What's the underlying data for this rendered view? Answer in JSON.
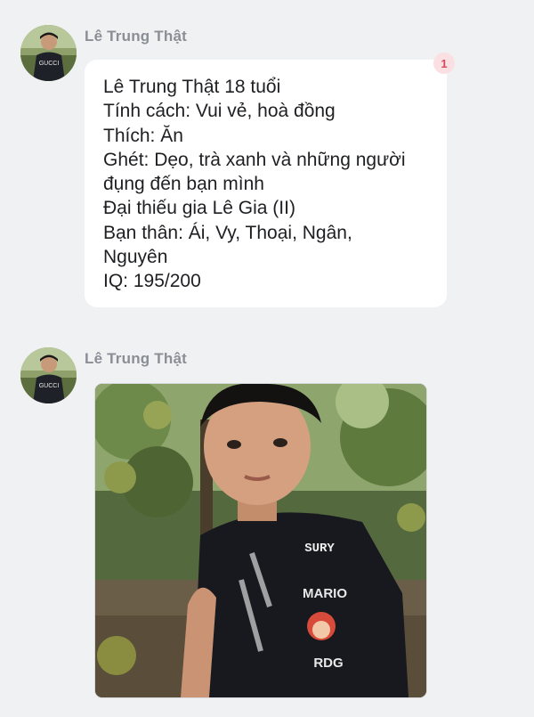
{
  "messages": [
    {
      "sender": "Lê Trung Thật",
      "avatar_icon": "person-avatar",
      "text_lines": [
        "Lê Trung Thật 18 tuổi",
        "Tính cách: Vui vẻ, hoà đồng",
        "Thích: Ăn",
        "Ghét: Dẹo, trà xanh và những người",
        "đụng đến bạn mình",
        "Đại thiếu gia Lê Gia (II)",
        "Bạn thân: Ái, Vy, Thoại, Ngân,",
        "Nguyên",
        "IQ: 195/200"
      ],
      "reaction_count": "1"
    },
    {
      "sender": "Lê Trung Thật",
      "avatar_icon": "person-avatar",
      "photo": {
        "shirt_text_top": "SURY",
        "shirt_text_mid": "MARIO",
        "shirt_text_bottom": "RDG"
      }
    }
  ],
  "avatar": {
    "shirt_text": "GUCCI"
  },
  "colors": {
    "background": "#f0f1f3",
    "bubble": "#ffffff",
    "text": "#1e1f22",
    "name": "#8a8e95",
    "badge_bg": "#fbe0e3",
    "badge_text": "#d24b5e"
  }
}
